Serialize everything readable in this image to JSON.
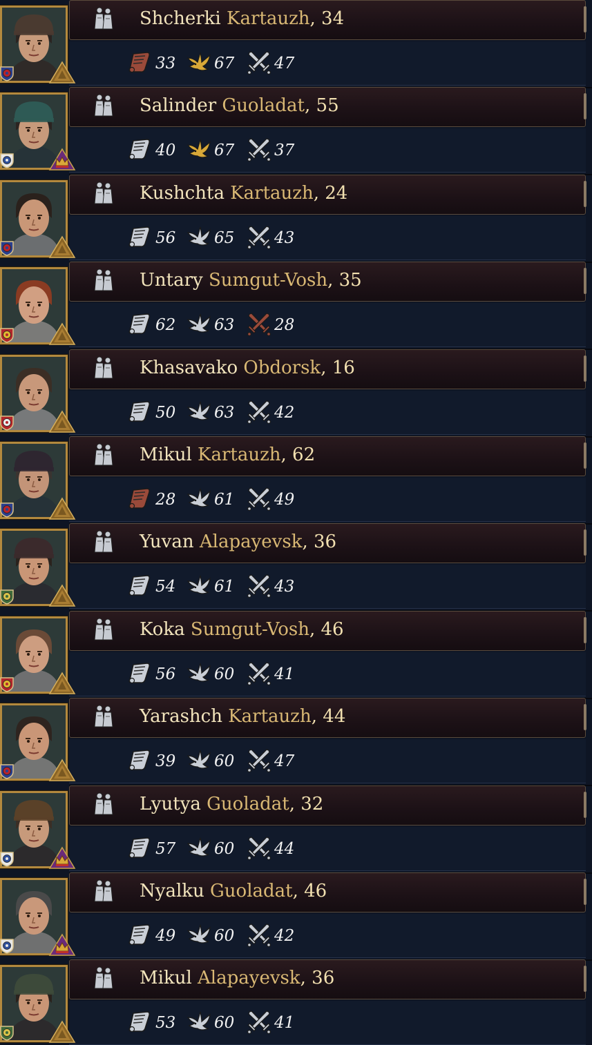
{
  "characters": [
    {
      "first": "Shcherki",
      "house": "Kartauzh",
      "age": ", 34",
      "diplomacy": "33",
      "intrigue": "67",
      "martial": "47",
      "diplomacy_tier": "low",
      "intrigue_tier": "high",
      "martial_tier": "normal",
      "culture": "red-blue",
      "rank": "gold",
      "hair": "#2b2421",
      "hat": "#4a3a30",
      "skin": "#c79a7b",
      "clothes": "#2f2a28"
    },
    {
      "first": "Salinder",
      "house": "Guoladat",
      "age": ", 55",
      "diplomacy": "40",
      "intrigue": "67",
      "martial": "37",
      "diplomacy_tier": "normal",
      "intrigue_tier": "high",
      "martial_tier": "normal",
      "culture": "blue-white",
      "rank": "crown",
      "hair": "#2b2421",
      "hat": "#2e5a55",
      "skin": "#c79a7b",
      "clothes": "#263338"
    },
    {
      "first": "Kushchta",
      "house": "Kartauzh",
      "age": ", 24",
      "diplomacy": "56",
      "intrigue": "65",
      "martial": "43",
      "diplomacy_tier": "normal",
      "intrigue_tier": "normal",
      "martial_tier": "normal",
      "culture": "red-blue",
      "rank": "gold",
      "hair": "#2a211c",
      "hat": "",
      "skin": "#c99777",
      "clothes": "#6b6e70"
    },
    {
      "first": "Untary",
      "house": "Sumgut-Vosh",
      "age": ", 35",
      "diplomacy": "62",
      "intrigue": "63",
      "martial": "28",
      "diplomacy_tier": "normal",
      "intrigue_tier": "normal",
      "martial_tier": "low",
      "culture": "yellow-red",
      "rank": "gold",
      "hair": "#8a3b22",
      "hat": "",
      "skin": "#d19f82",
      "clothes": "#7a7a78"
    },
    {
      "first": "Khasavako",
      "house": "Obdorsk",
      "age": ", 16",
      "diplomacy": "50",
      "intrigue": "63",
      "martial": "42",
      "diplomacy_tier": "normal",
      "intrigue_tier": "normal",
      "martial_tier": "normal",
      "culture": "white-red",
      "rank": "gold",
      "hair": "#3b2e25",
      "hat": "",
      "skin": "#c8987a",
      "clothes": "#77797a"
    },
    {
      "first": "Mikul",
      "house": "Kartauzh",
      "age": ", 62",
      "diplomacy": "28",
      "intrigue": "61",
      "martial": "49",
      "diplomacy_tier": "low",
      "intrigue_tier": "normal",
      "martial_tier": "normal",
      "culture": "red-blue",
      "rank": "gold",
      "hair": "#3a3430",
      "hat": "#2e2630",
      "skin": "#c39478",
      "clothes": "#263238"
    },
    {
      "first": "Yuvan",
      "house": "Alapayevsk",
      "age": ", 36",
      "diplomacy": "54",
      "intrigue": "61",
      "martial": "43",
      "diplomacy_tier": "normal",
      "intrigue_tier": "normal",
      "martial_tier": "normal",
      "culture": "yellow-green",
      "rank": "gold",
      "hair": "#2a221d",
      "hat": "#3b2a2c",
      "skin": "#c99676",
      "clothes": "#2a2b30"
    },
    {
      "first": "Koka",
      "house": "Sumgut-Vosh",
      "age": ", 46",
      "diplomacy": "56",
      "intrigue": "60",
      "martial": "41",
      "diplomacy_tier": "normal",
      "intrigue_tier": "normal",
      "martial_tier": "normal",
      "culture": "yellow-red",
      "rank": "gold",
      "hair": "#6a4a37",
      "hat": "",
      "skin": "#cd9d80",
      "clothes": "#6e6f70"
    },
    {
      "first": "Yarashch",
      "house": "Kartauzh",
      "age": ", 44",
      "diplomacy": "39",
      "intrigue": "60",
      "martial": "47",
      "diplomacy_tier": "normal",
      "intrigue_tier": "normal",
      "martial_tier": "normal",
      "culture": "red-blue",
      "rank": "gold",
      "hair": "#2e241f",
      "hat": "",
      "skin": "#c99677",
      "clothes": "#747574"
    },
    {
      "first": "Lyutya",
      "house": "Guoladat",
      "age": ", 32",
      "diplomacy": "57",
      "intrigue": "60",
      "martial": "44",
      "diplomacy_tier": "normal",
      "intrigue_tier": "normal",
      "martial_tier": "normal",
      "culture": "blue-white",
      "rank": "crown",
      "hair": "#3a2e25",
      "hat": "#5a4128",
      "skin": "#c79a7b",
      "clothes": "#2c2a2c"
    },
    {
      "first": "Nyalku",
      "house": "Guoladat",
      "age": ", 46",
      "diplomacy": "49",
      "intrigue": "60",
      "martial": "42",
      "diplomacy_tier": "normal",
      "intrigue_tier": "normal",
      "martial_tier": "normal",
      "culture": "blue-white",
      "rank": "crown",
      "hair": "#4a4a4a",
      "hat": "",
      "skin": "#c9987a",
      "clothes": "#6f7070"
    },
    {
      "first": "Mikul",
      "house": "Alapayevsk",
      "age": ", 36",
      "diplomacy": "53",
      "intrigue": "60",
      "martial": "41",
      "diplomacy_tier": "normal",
      "intrigue_tier": "normal",
      "martial_tier": "normal",
      "culture": "yellow-green",
      "rank": "gold",
      "hair": "#2a221d",
      "hat": "#3d4a3a",
      "skin": "#c99676",
      "clothes": "#2c2a2c"
    }
  ],
  "colors": {
    "name_first": "#f2e4bc",
    "name_house": "#d9b874",
    "stat_value": "#f2f2f2",
    "frame_gold": "#b3893e",
    "icon_normal": "#c9ced6",
    "icon_high": "#d8a838",
    "icon_low": "#9a4a3a"
  },
  "icons": {
    "pawn": "character-pawn-icon",
    "diplomacy": "scroll-icon",
    "intrigue": "dove-icon",
    "martial": "crossed-swords-icon"
  }
}
